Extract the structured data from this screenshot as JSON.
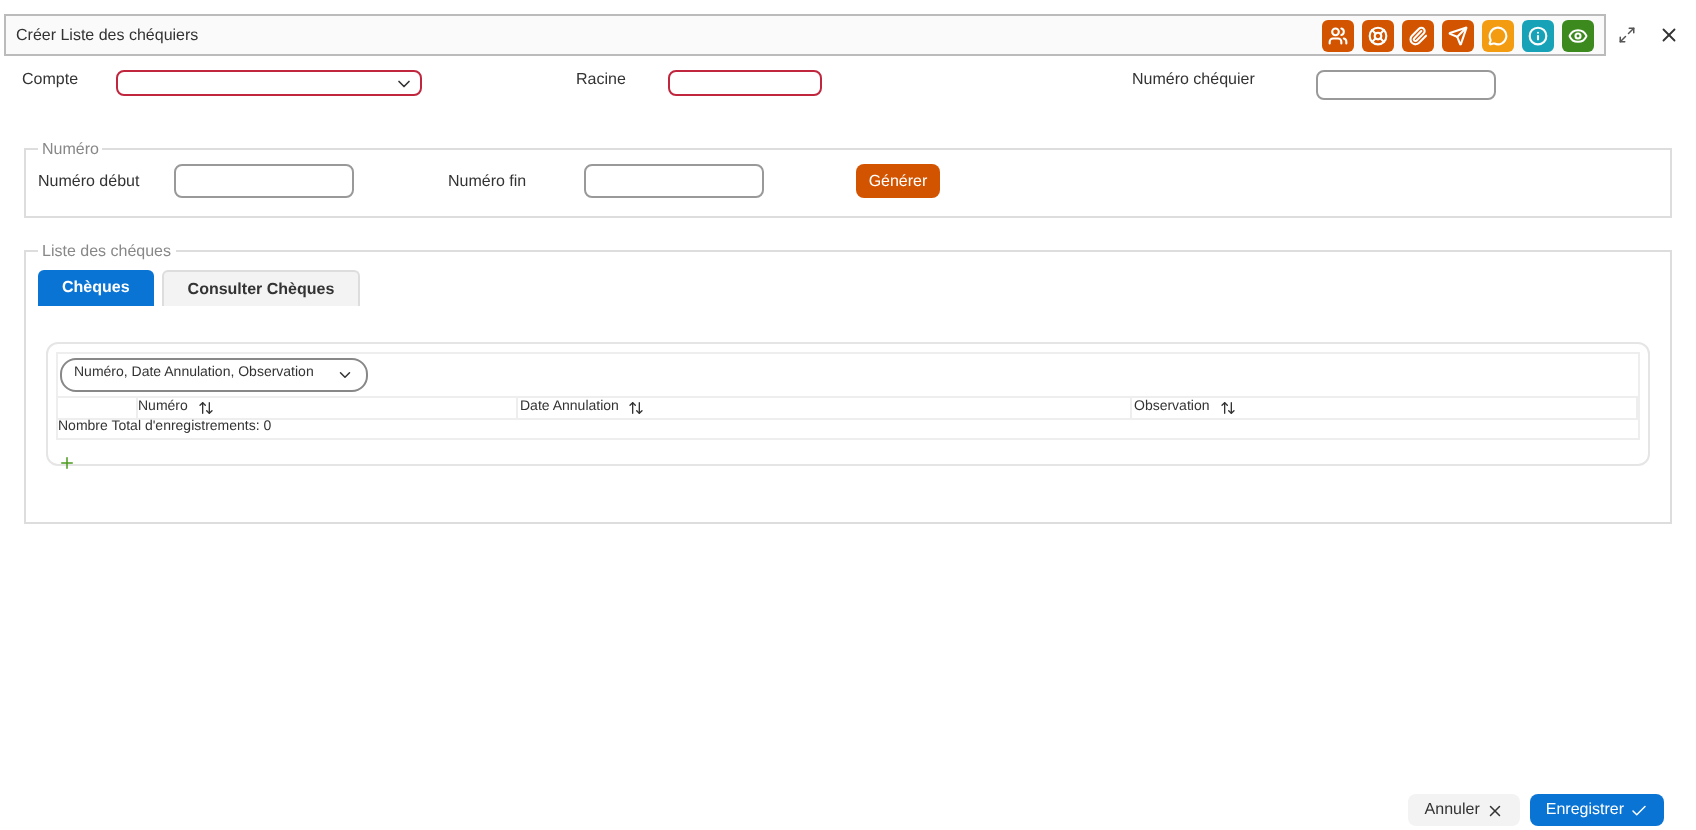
{
  "window": {
    "title": "Créer Liste des chéquiers"
  },
  "toolbar": [
    {
      "kind": "users",
      "color": "#d35400"
    },
    {
      "kind": "support",
      "color": "#d35400"
    },
    {
      "kind": "attach",
      "color": "#d35400"
    },
    {
      "kind": "send",
      "color": "#d35400"
    },
    {
      "kind": "comment",
      "color": "#f39c12"
    },
    {
      "kind": "info",
      "color": "#17a2b8"
    },
    {
      "kind": "eye",
      "color": "#3c8a1e"
    }
  ],
  "fields": [
    {
      "label": "Compte",
      "kind": "select",
      "required": true
    },
    {
      "label": "Racine",
      "kind": "text",
      "required": true
    },
    {
      "label": "Numéro chéquier",
      "kind": "text",
      "required": false
    }
  ],
  "numero": {
    "legend": "Numéro",
    "start_label": "Numéro début",
    "end_label": "Numéro fin",
    "button": "Générer"
  },
  "cheques": {
    "legend": "Liste des chéques",
    "tabs": [
      {
        "label": "Chèques",
        "selected": true
      },
      {
        "label": "Consulter Chèques",
        "selected": false
      }
    ],
    "column_picker": "Numéro, Date Annulation, Observation",
    "columns": [
      "Numéro",
      "Date Annulation",
      "Observation"
    ],
    "total": "Nombre Total d'enregistrements: 0"
  },
  "buttons": [
    {
      "label": "Annuler",
      "kind": "cancel"
    },
    {
      "label": "Enregistrer",
      "kind": "save"
    }
  ]
}
